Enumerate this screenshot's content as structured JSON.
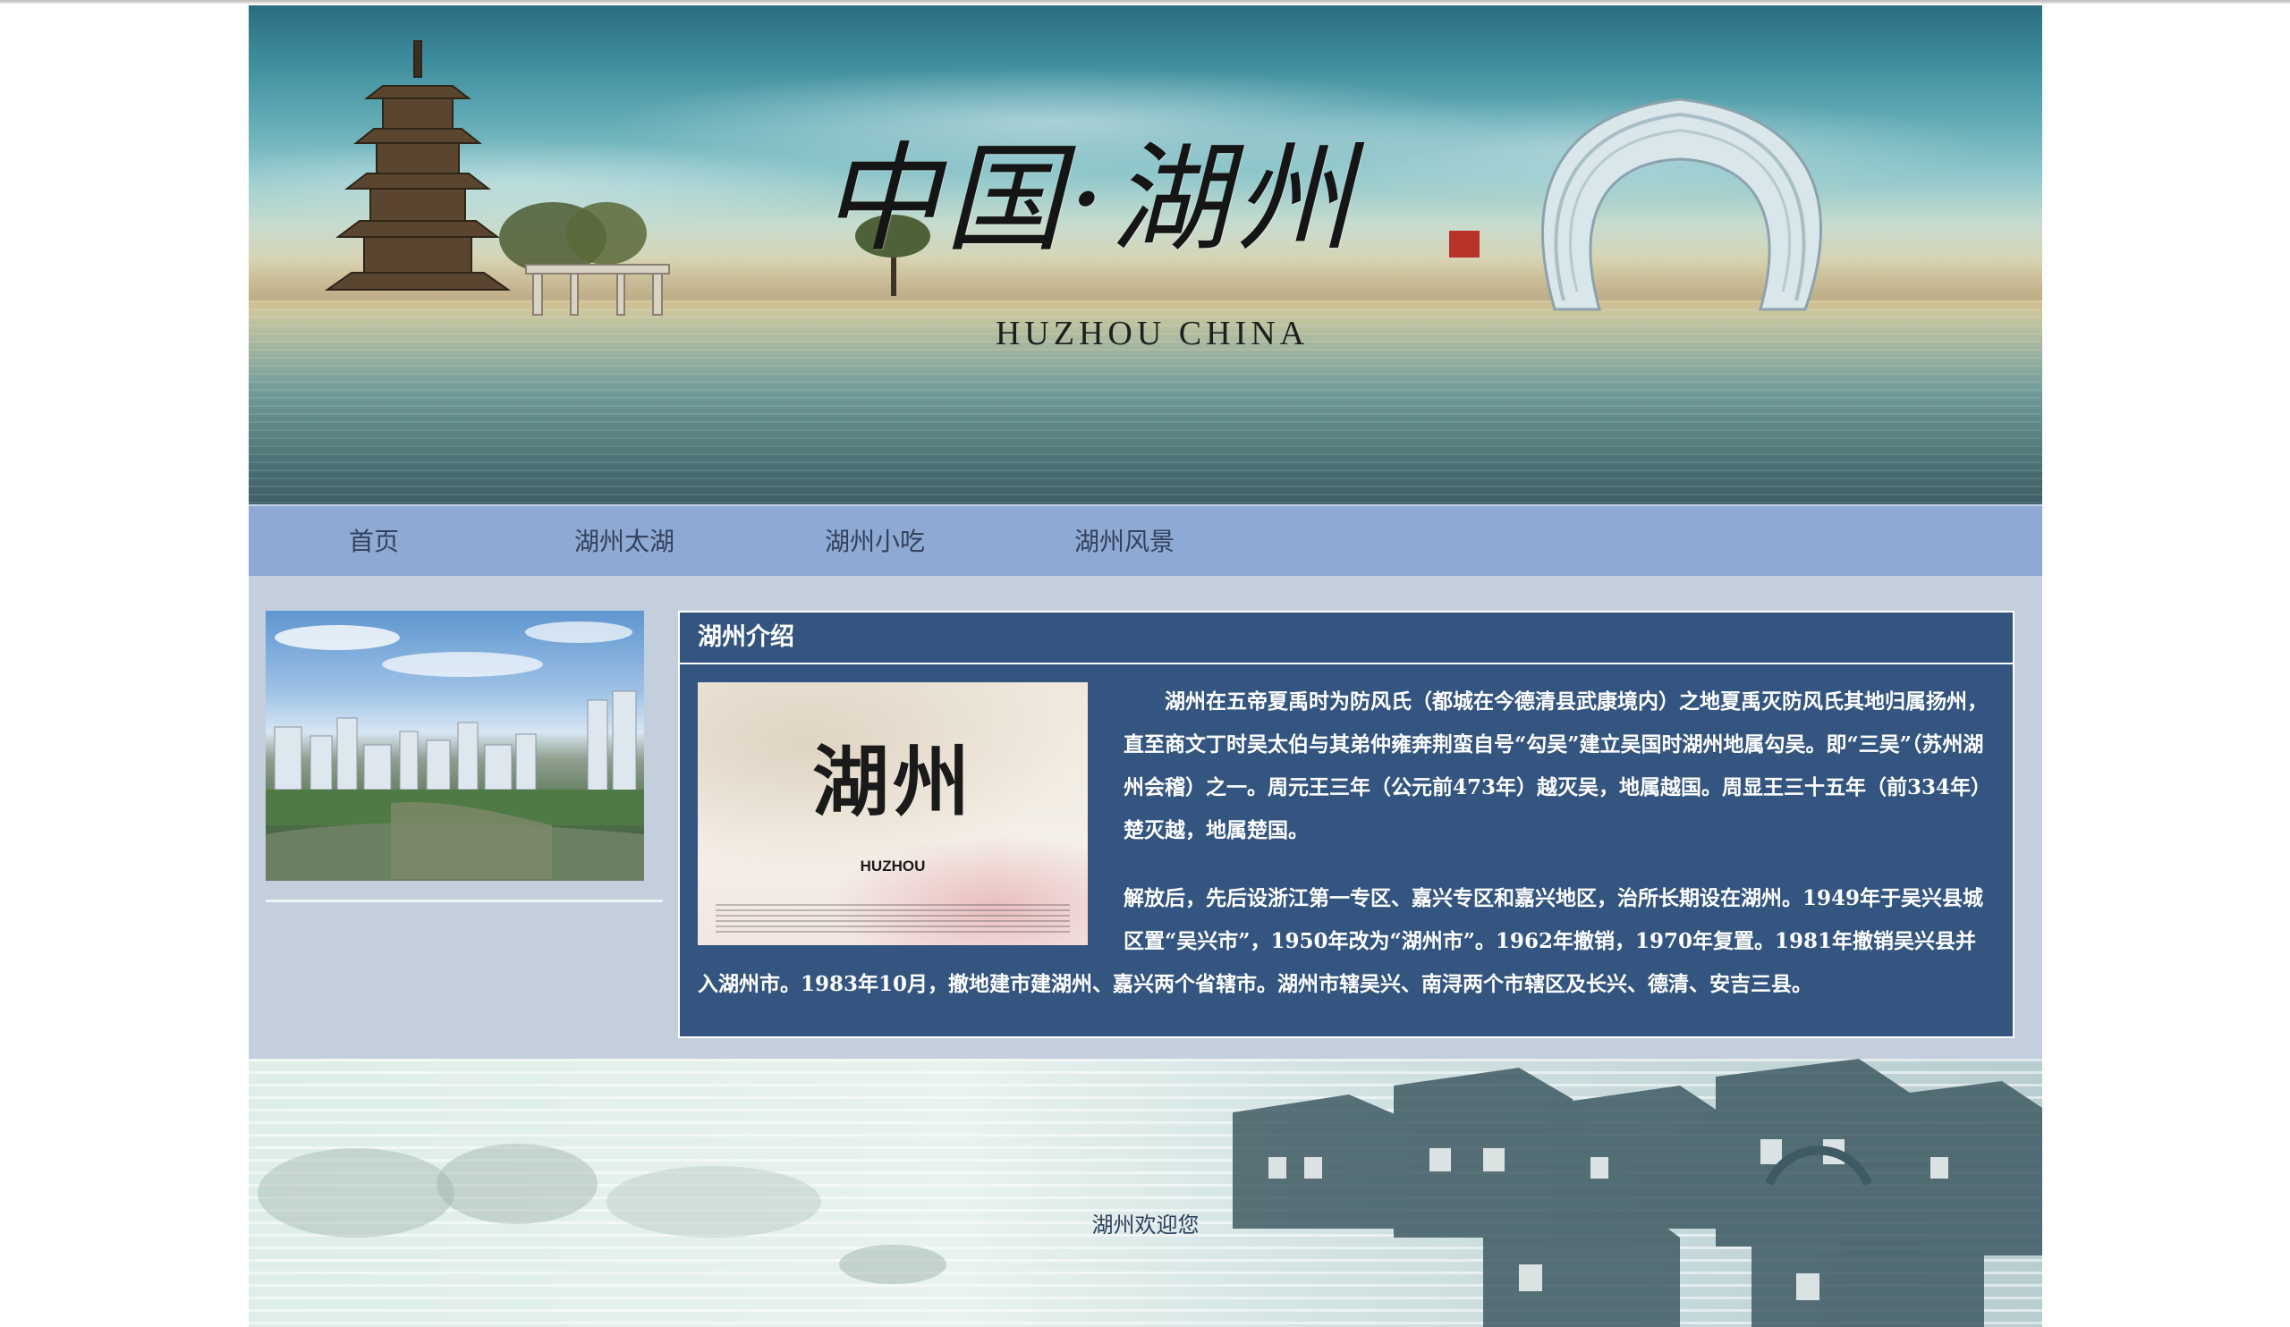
{
  "banner": {
    "title_cn": "中国·湖州",
    "title_en": "HUZHOU CHINA"
  },
  "nav": {
    "items": [
      {
        "label": "首页"
      },
      {
        "label": "湖州太湖"
      },
      {
        "label": "湖州小吃"
      },
      {
        "label": "湖州风景"
      }
    ]
  },
  "panel": {
    "title": "湖州介绍",
    "image": {
      "calligraphy": "湖州",
      "caption": "HUZHOU"
    },
    "paragraphs": [
      "湖州在五帝夏禹时为防风氏（都城在今德清县武康境内）之地夏禹灭防风氏其地归属扬州，直至商文丁时吴太伯与其弟仲雍奔荆蛮自号“勾吴”建立吴国时湖州地属勾吴。即“三吴”（苏州湖州会稽）之一。周元王三年（公元前473年）越灭吴，地属越国。周显王三十五年（前334年）楚灭越，地属楚国。",
      "解放后，先后设浙江第一专区、嘉兴专区和嘉兴地区，治所长期设在湖州。1949年于吴兴县城区置“吴兴市”，1950年改为“湖州市”。1962年撤销，1970年复置。1981年撤销吴兴县并入湖州市。1983年10月，撤地建市建湖州、嘉兴两个省辖市。湖州市辖吴兴、南浔两个市辖区及长兴、德清、安吉三县。"
    ]
  },
  "footer": {
    "text": "湖州欢迎您"
  }
}
